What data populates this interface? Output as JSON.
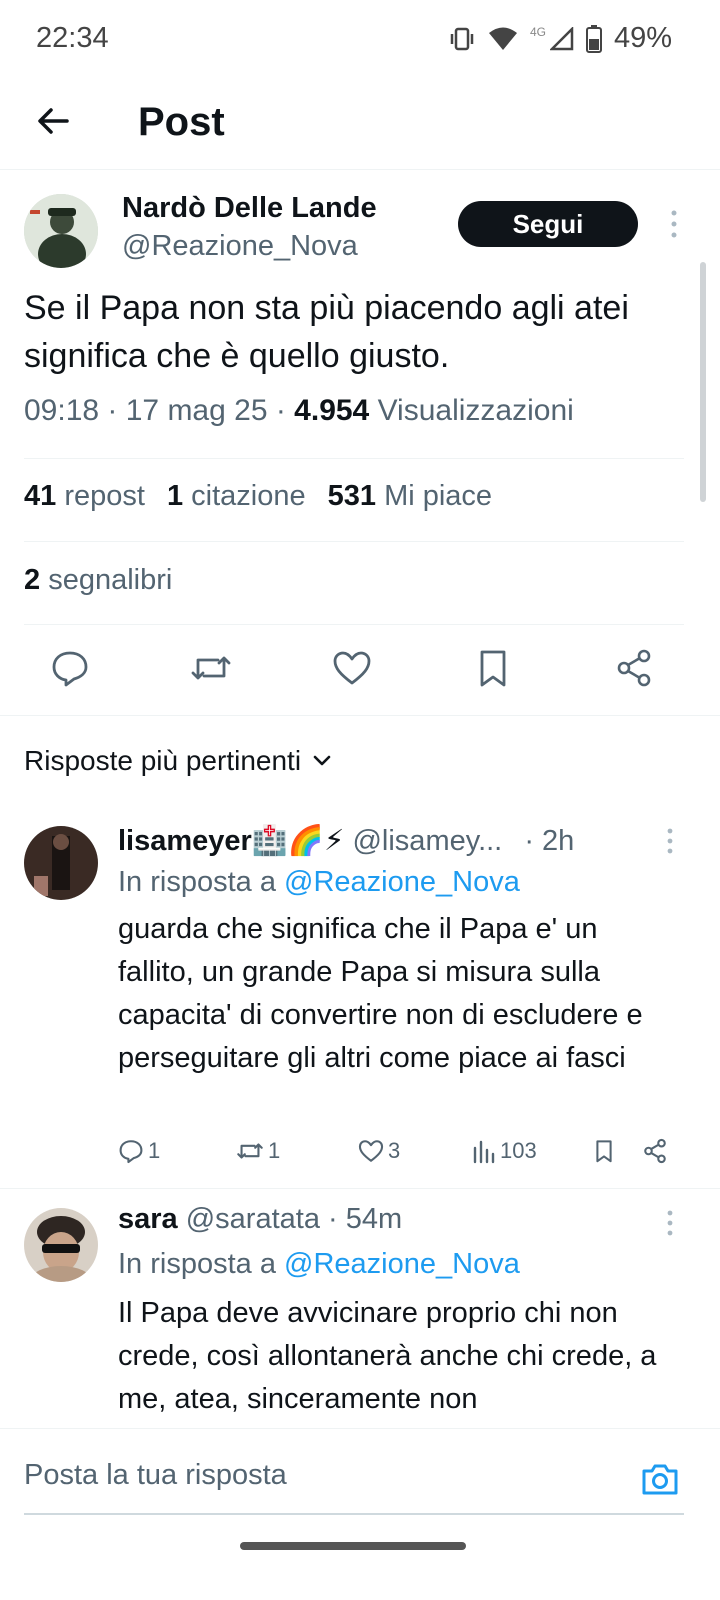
{
  "status": {
    "time": "22:34",
    "network": "4G",
    "battery": "49%"
  },
  "header": {
    "title": "Post"
  },
  "post": {
    "author_name": "Nardò Delle Lande",
    "author_handle": "@Reazione_Nova",
    "follow_label": "Segui",
    "text": "Se il Papa non sta più piacendo agli atei significa che è quello giusto.",
    "time": "09:18 · 17 mag 25 · ",
    "views_count": "4.954",
    "views_label": " Visualizzazioni",
    "reposts_count": "41",
    "reposts_label": "repost",
    "quotes_count": "1",
    "quotes_label": "citazione",
    "likes_count": "531",
    "likes_label": "Mi piace",
    "bookmarks_count": "2",
    "bookmarks_label": "segnalibri"
  },
  "sort": {
    "label": "Risposte più pertinenti"
  },
  "replies": [
    {
      "name": "lisameyer🏥🌈⚡",
      "handle": "@lisamey...",
      "time": "· 2h",
      "reply_to_prefix": "In risposta a ",
      "reply_to": "@Reazione_Nova",
      "text": "guarda che significa che il Papa e' un fallito, un grande Papa si misura sulla capacita' di convertire non di escludere e perseguitare gli altri come piace ai fasci",
      "replies": "1",
      "reposts": "1",
      "likes": "3",
      "views": "103"
    },
    {
      "name": "sara",
      "handle": "@saratata",
      "time": "· 54m",
      "reply_to_prefix": "In risposta a ",
      "reply_to": "@Reazione_Nova",
      "text": "Il Papa deve avvicinare proprio chi non crede, così allontanerà anche chi crede, a me, atea, sinceramente non"
    }
  ],
  "compose": {
    "placeholder": "Posta la tua risposta"
  }
}
